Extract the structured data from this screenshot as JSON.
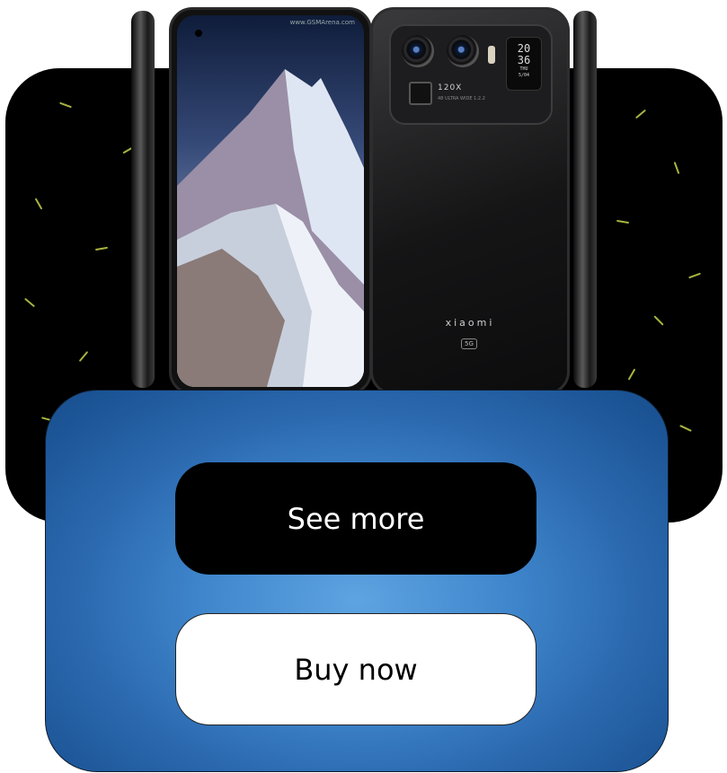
{
  "product": {
    "watermark": "www.GSMArena.com",
    "zoom_label": "120X",
    "zoom_spec": "48 ULTRA WIDE 1:2.2",
    "mini_screen": {
      "time_hour": "20",
      "time_min": "36",
      "sub1": "THU",
      "sub2": "5/04"
    },
    "brand": "xiaomi",
    "network_badge": "5G"
  },
  "actions": {
    "see_more_label": "See more",
    "buy_now_label": "Buy now"
  },
  "colors": {
    "backdrop": "#000000",
    "panel_accent": "#3f86cc",
    "see_more_bg": "#000000",
    "buy_now_bg": "#ffffff"
  }
}
